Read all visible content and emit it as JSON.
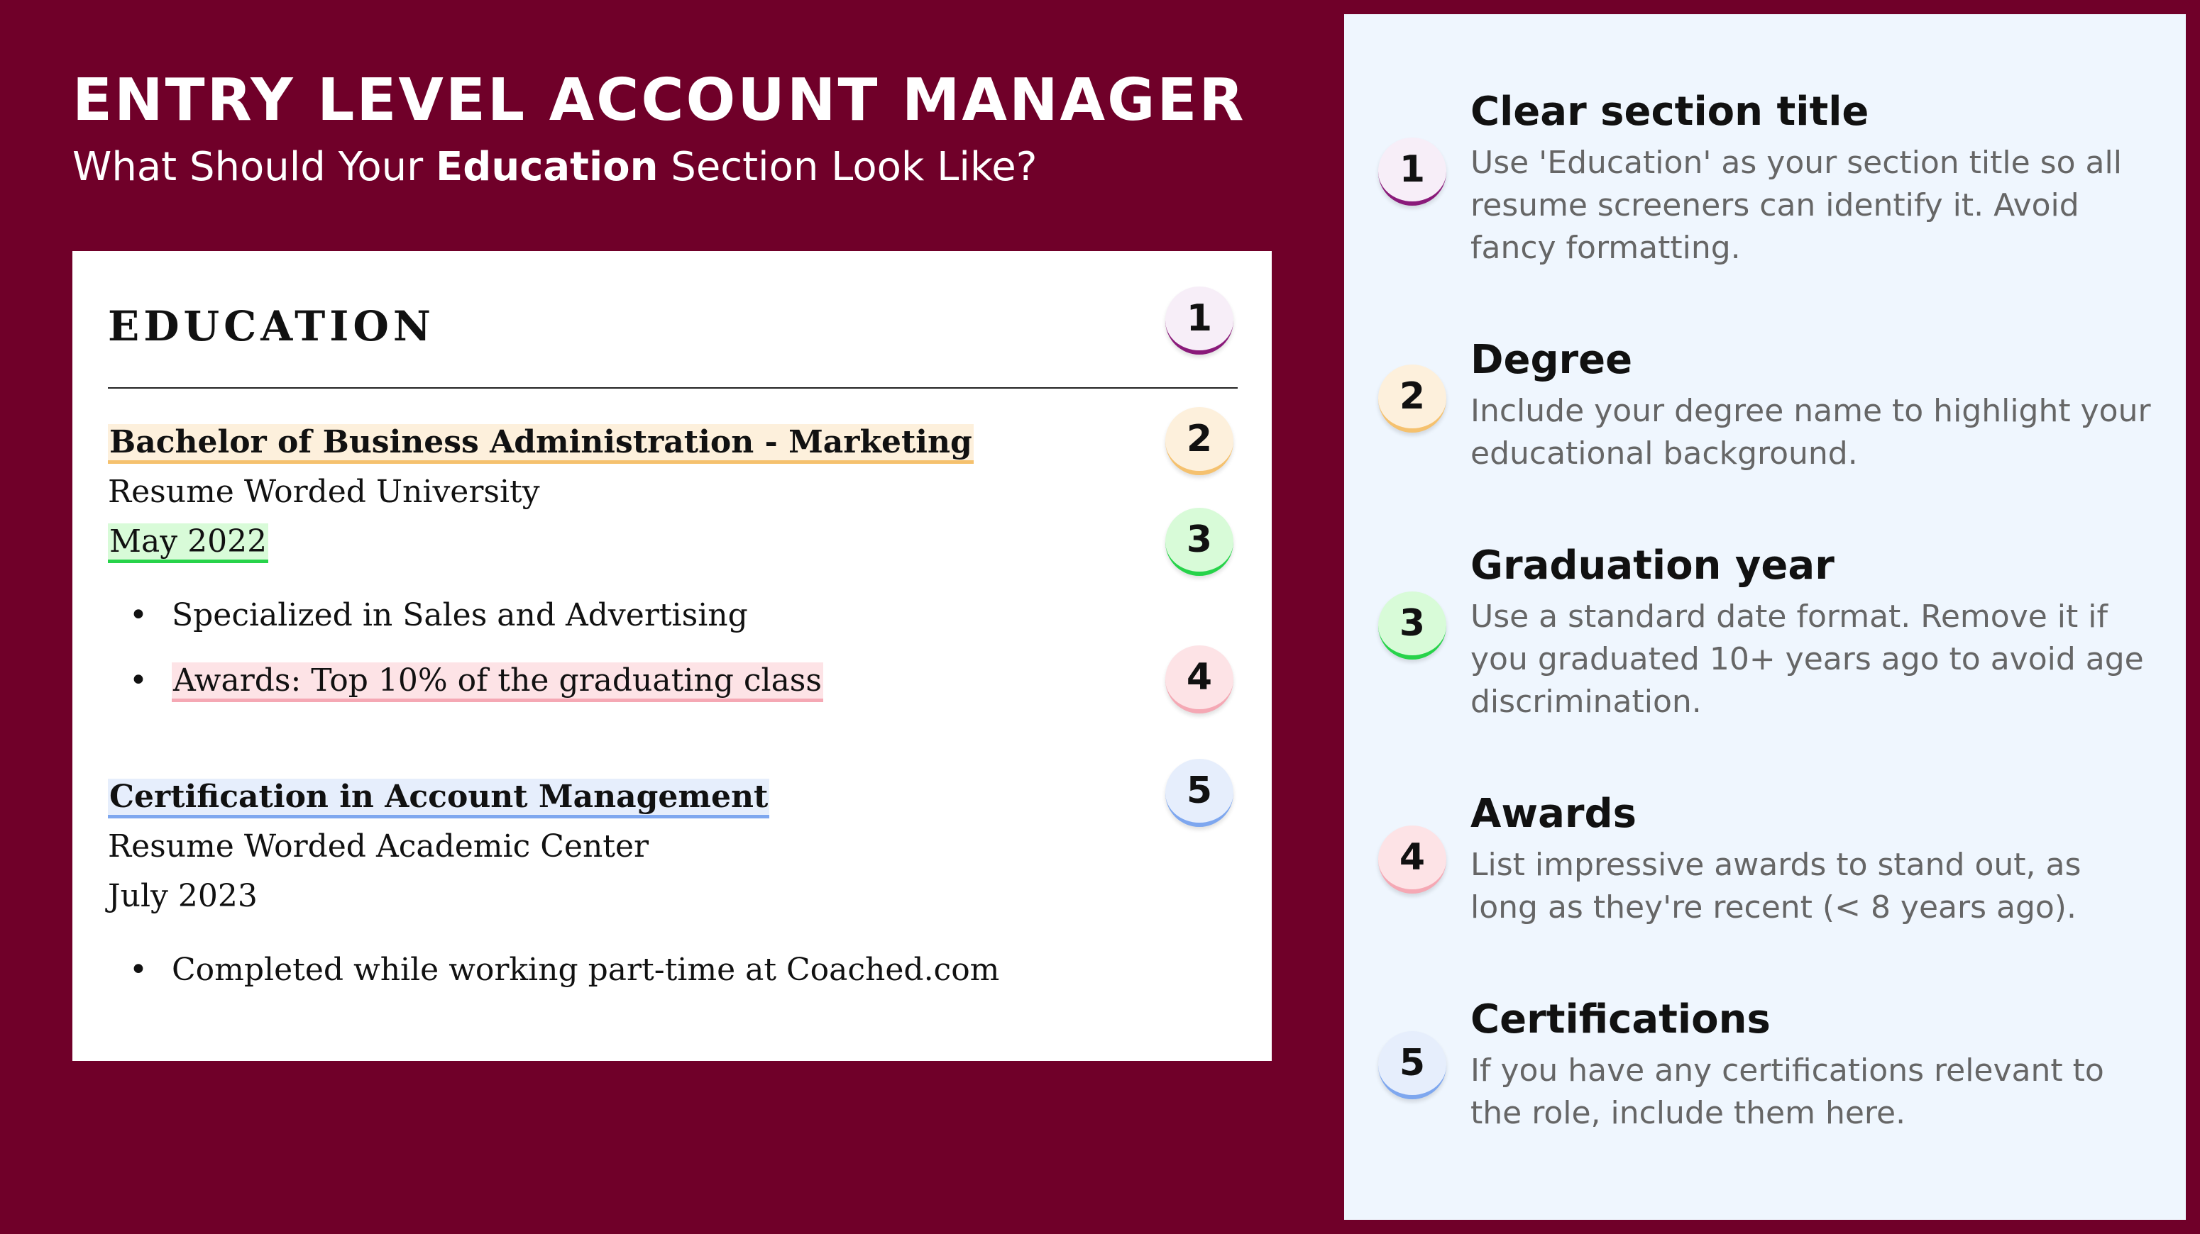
{
  "header": {
    "title": "ENTRY LEVEL ACCOUNT MANAGER",
    "subtitle_prefix": "What Should Your ",
    "subtitle_bold": "Education",
    "subtitle_suffix": " Section Look Like?"
  },
  "resume": {
    "section_heading": "EDUCATION",
    "entries": [
      {
        "degree": "Bachelor of Business Administration - Marketing",
        "institution": "Resume Worded University",
        "date": "May 2022",
        "bullets": [
          "Specialized in Sales and Advertising",
          "Awards: Top 10% of the graduating class"
        ]
      },
      {
        "degree": "Certification in Account Management",
        "institution": "Resume Worded Academic Center",
        "date": "July 2023",
        "bullets": [
          "Completed while working part-time at Coached.com"
        ]
      }
    ],
    "badges": [
      "1",
      "2",
      "3",
      "4",
      "5"
    ]
  },
  "tips": [
    {
      "number": "1",
      "title": "Clear section title",
      "description": "Use 'Education' as your section title so all resume screeners can identify it. Avoid fancy formatting."
    },
    {
      "number": "2",
      "title": "Degree",
      "description": "Include your degree name to highlight your educational background."
    },
    {
      "number": "3",
      "title": "Graduation year",
      "description": "Use a standard date format. Remove it if you graduated 10+ years ago to avoid age discrimination."
    },
    {
      "number": "4",
      "title": "Awards",
      "description": "List impressive awards to stand out, as long as they're recent (< 8 years ago)."
    },
    {
      "number": "5",
      "title": "Certifications",
      "description": "If you have any certifications relevant to the role, include them here."
    }
  ],
  "colors": {
    "background": "#700029",
    "panel": "#eff6fe",
    "badge_1": "#8a1a7a",
    "badge_2": "#f5c16e",
    "badge_3": "#27d34a",
    "badge_4": "#f5a8b4",
    "badge_5": "#7ea7ef"
  }
}
